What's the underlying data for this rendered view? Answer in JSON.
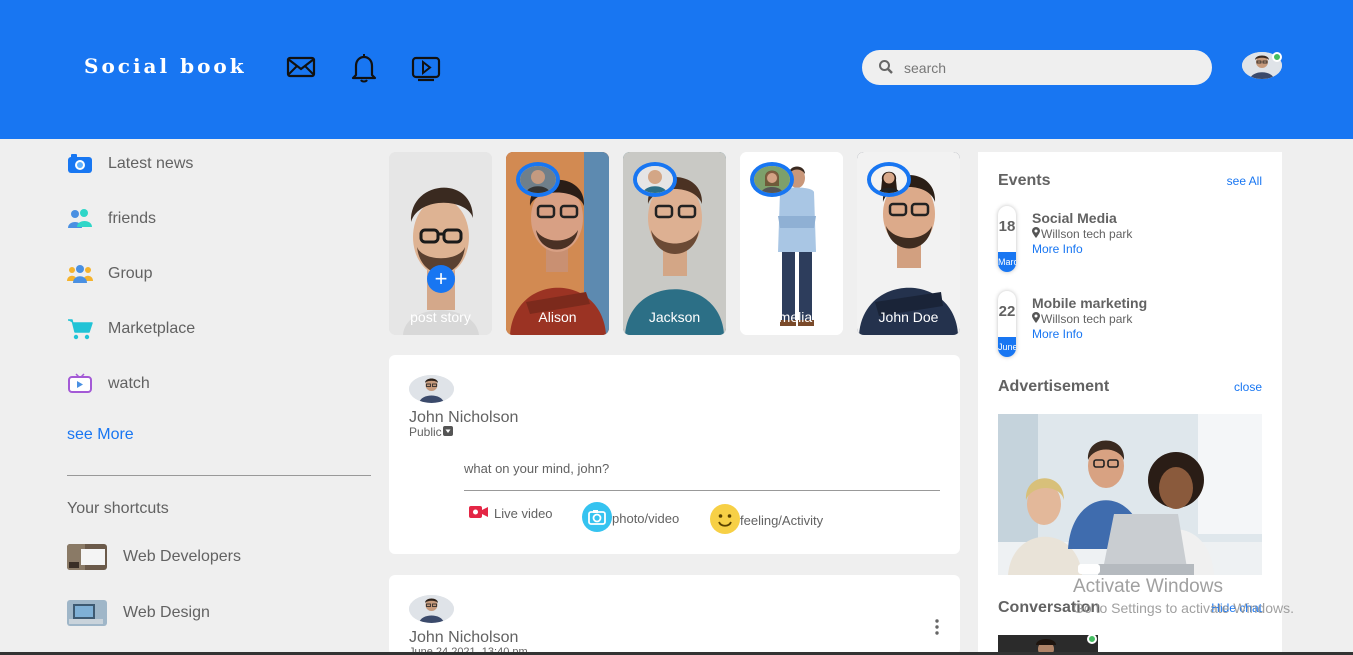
{
  "header": {
    "logo": "Social book",
    "icons": [
      "mail-icon",
      "bell-icon",
      "video-icon"
    ],
    "search": {
      "placeholder": "search",
      "value": ""
    },
    "colors": {
      "bar": "#1876f2",
      "online": "#45bd62"
    }
  },
  "sidebar": {
    "items": [
      {
        "label": "Latest news",
        "icon": "camera-icon"
      },
      {
        "label": "friends",
        "icon": "friends-icon"
      },
      {
        "label": "Group",
        "icon": "group-icon"
      },
      {
        "label": "Marketplace",
        "icon": "cart-icon"
      },
      {
        "label": "watch",
        "icon": "tv-icon"
      }
    ],
    "see_more": "see More",
    "shortcuts_title": "Your shortcuts",
    "shortcuts": [
      {
        "label": "Web Developers"
      },
      {
        "label": "Web Design"
      }
    ]
  },
  "stories": [
    {
      "label": "post story"
    },
    {
      "label": "Alison"
    },
    {
      "label": "Jackson"
    },
    {
      "label": "amelia"
    },
    {
      "label": "John Doe"
    }
  ],
  "composer": {
    "name": "John Nicholson",
    "privacy": "Public",
    "prompt": "what on your mind, john?",
    "actions": [
      {
        "label": "Live video",
        "icon": "live-video-icon"
      },
      {
        "label": "photo/video",
        "icon": "photo-icon"
      },
      {
        "label": "feeling/Activity",
        "icon": "smiley-icon"
      }
    ]
  },
  "post": {
    "name": "John Nicholson",
    "date": "June 24 2021, 13:40 pm"
  },
  "rightbar": {
    "events_title": "Events",
    "events_link": "see All",
    "events": [
      {
        "day": "18",
        "month": "March",
        "title": "Social Media",
        "place": "Willson tech park",
        "info": "More Info"
      },
      {
        "day": "22",
        "month": "June",
        "title": "Mobile marketing",
        "place": "Willson tech park",
        "info": "More Info"
      }
    ],
    "ad_title": "Advertisement",
    "ad_link": "close",
    "conversation_title": "Conversation",
    "conversation_link": "Hide chat"
  },
  "watermark": {
    "line1": "Activate Windows",
    "line2": "Go to Settings to activate Windows."
  }
}
